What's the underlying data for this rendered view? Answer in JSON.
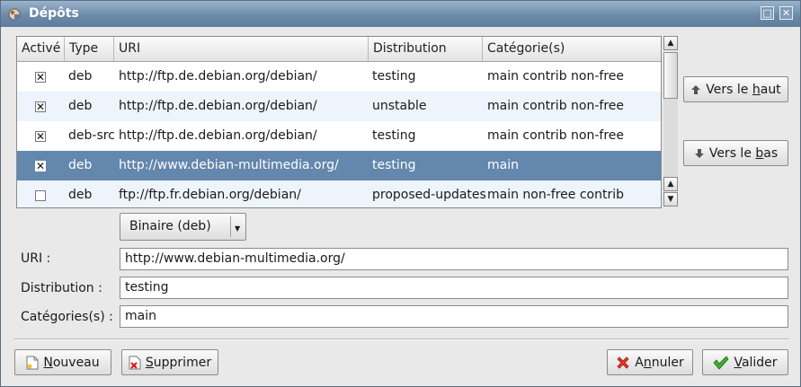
{
  "window": {
    "title": "Dépôts"
  },
  "table": {
    "columns": [
      "Activé",
      "Type",
      "URI",
      "Distribution",
      "Catégorie(s)"
    ],
    "rows": [
      {
        "enabled": true,
        "type": "deb",
        "uri": "http://ftp.de.debian.org/debian/",
        "distribution": "testing",
        "categories": "main contrib non-free"
      },
      {
        "enabled": true,
        "type": "deb",
        "uri": "http://ftp.de.debian.org/debian/",
        "distribution": "unstable",
        "categories": "main contrib non-free"
      },
      {
        "enabled": true,
        "type": "deb-src",
        "uri": "http://ftp.de.debian.org/debian/",
        "distribution": "testing",
        "categories": "main contrib non-free"
      },
      {
        "enabled": true,
        "type": "deb",
        "uri": "http://www.debian-multimedia.org/",
        "distribution": "testing",
        "categories": "main",
        "selected": true
      },
      {
        "enabled": false,
        "type": "deb",
        "uri": "ftp://ftp.fr.debian.org/debian/",
        "distribution": "proposed-updates",
        "categories": "main non-free contrib"
      }
    ]
  },
  "side_buttons": {
    "up": {
      "prefix": "Vers le ",
      "mnemonic": "h",
      "rest": "aut"
    },
    "down": {
      "prefix": "Vers le ",
      "mnemonic": "b",
      "rest": "as"
    }
  },
  "type_select": {
    "value": "Binaire (deb)"
  },
  "form": {
    "uri_label": "URI :",
    "uri_value": "http://www.debian-multimedia.org/",
    "distribution_label": "Distribution :",
    "distribution_value": "testing",
    "categories_label": "Catégories(s) :",
    "categories_value": "main"
  },
  "bottom_buttons": {
    "new": {
      "mnemonic": "N",
      "rest": "ouveau"
    },
    "delete": {
      "mnemonic": "S",
      "rest": "upprimer"
    },
    "cancel": {
      "prefix": "A",
      "mnemonic": "n",
      "rest": "nuler"
    },
    "ok": {
      "mnemonic": "V",
      "rest": "alider"
    }
  },
  "colors": {
    "titlebar": "#6c8aa8",
    "selection": "#6387ad",
    "alt_row": "#eef4fb"
  }
}
